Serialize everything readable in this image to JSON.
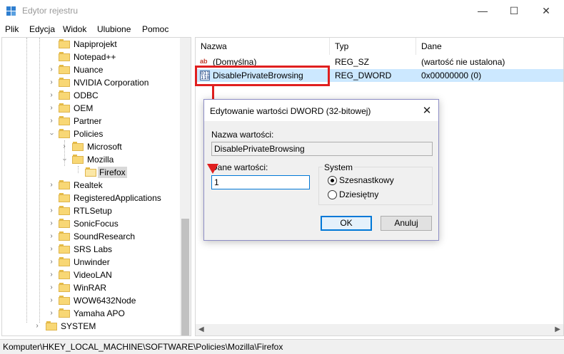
{
  "window": {
    "title": "Edytor rejestru",
    "controls": {
      "minimize": "—",
      "maximize": "☐",
      "close": "✕"
    }
  },
  "menu": [
    "Plik",
    "Edycja",
    "Widok",
    "Ulubione",
    "Pomoc"
  ],
  "tree": {
    "items": [
      {
        "label": "Napiprojekt"
      },
      {
        "label": "Notepad++"
      },
      {
        "label": "Nuance"
      },
      {
        "label": "NVIDIA Corporation"
      },
      {
        "label": "ODBC"
      },
      {
        "label": "OEM"
      },
      {
        "label": "Partner"
      },
      {
        "label": "Policies"
      },
      {
        "label": "Microsoft"
      },
      {
        "label": "Mozilla"
      },
      {
        "label": "Firefox"
      },
      {
        "label": "Realtek"
      },
      {
        "label": "RegisteredApplications"
      },
      {
        "label": "RTLSetup"
      },
      {
        "label": "SonicFocus"
      },
      {
        "label": "SoundResearch"
      },
      {
        "label": "SRS Labs"
      },
      {
        "label": "Unwinder"
      },
      {
        "label": "VideoLAN"
      },
      {
        "label": "WinRAR"
      },
      {
        "label": "WOW6432Node"
      },
      {
        "label": "Yamaha APO"
      },
      {
        "label": "SYSTEM"
      }
    ]
  },
  "list": {
    "columns": [
      "Nazwa",
      "Typ",
      "Dane"
    ],
    "rows": [
      {
        "icon": "string-value-icon",
        "icon_text": "ab",
        "name": "(Domyślna)",
        "type": "REG_SZ",
        "data": "(wartość nie ustalona)"
      },
      {
        "icon": "binary-value-icon",
        "icon_text": "011\n110",
        "name": "DisablePrivateBrowsing",
        "type": "REG_DWORD",
        "data": "0x00000000 (0)"
      }
    ]
  },
  "dialog": {
    "title": "Edytowanie wartości DWORD (32-bitowej)",
    "close": "✕",
    "name_label": "Nazwa wartości:",
    "name_value": "DisablePrivateBrowsing",
    "data_label": "Dane wartości:",
    "data_value": "1",
    "base_group": "System",
    "base_hex": "Szesnastkowy",
    "base_dec": "Dziesiętny",
    "ok": "OK",
    "cancel": "Anuluj"
  },
  "status": {
    "path": "Komputer\\HKEY_LOCAL_MACHINE\\SOFTWARE\\Policies\\Mozilla\\Firefox"
  },
  "colors": {
    "annotation": "#e01f1f",
    "selection": "#cce8ff",
    "accent": "#0078d7",
    "folder": "#f8d775"
  }
}
